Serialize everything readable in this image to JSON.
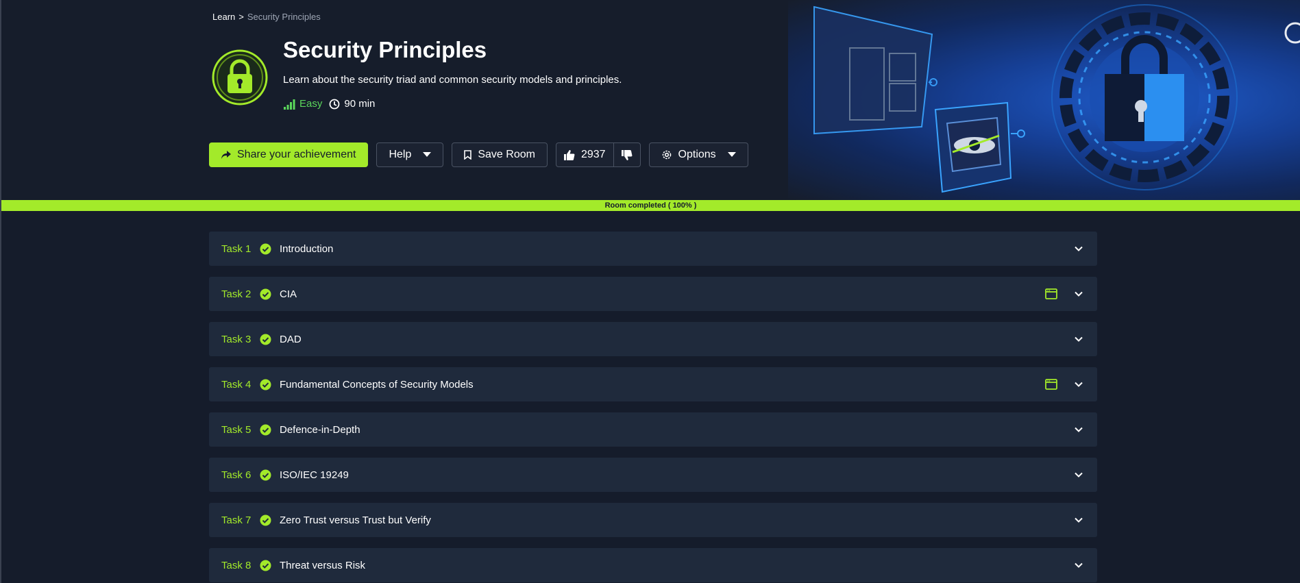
{
  "breadcrumb": {
    "root": "Learn",
    "separator": ">",
    "current": "Security Principles"
  },
  "room": {
    "title": "Security Principles",
    "description": "Learn about the security triad and common security models and principles.",
    "difficulty": "Easy",
    "duration": "90 min",
    "icon": "padlock-icon"
  },
  "actions": {
    "share": "Share your achievement",
    "help": "Help",
    "save": "Save Room",
    "upvotes": "2937",
    "options": "Options"
  },
  "progress": {
    "percent": 100,
    "label": "Room completed ( 100% )"
  },
  "tasks": [
    {
      "num": "Task 1",
      "title": "Introduction",
      "machine": false
    },
    {
      "num": "Task 2",
      "title": "CIA",
      "machine": true
    },
    {
      "num": "Task 3",
      "title": "DAD",
      "machine": false
    },
    {
      "num": "Task 4",
      "title": "Fundamental Concepts of Security Models",
      "machine": true
    },
    {
      "num": "Task 5",
      "title": "Defence-in-Depth",
      "machine": false
    },
    {
      "num": "Task 6",
      "title": "ISO/IEC 19249",
      "machine": false
    },
    {
      "num": "Task 7",
      "title": "Zero Trust versus Trust but Verify",
      "machine": false
    },
    {
      "num": "Task 8",
      "title": "Threat versus Risk",
      "machine": false
    }
  ],
  "colors": {
    "accent": "#a3ea2a",
    "background": "#151c2b",
    "card": "#1f2a3c",
    "easy": "#5bd65b"
  }
}
